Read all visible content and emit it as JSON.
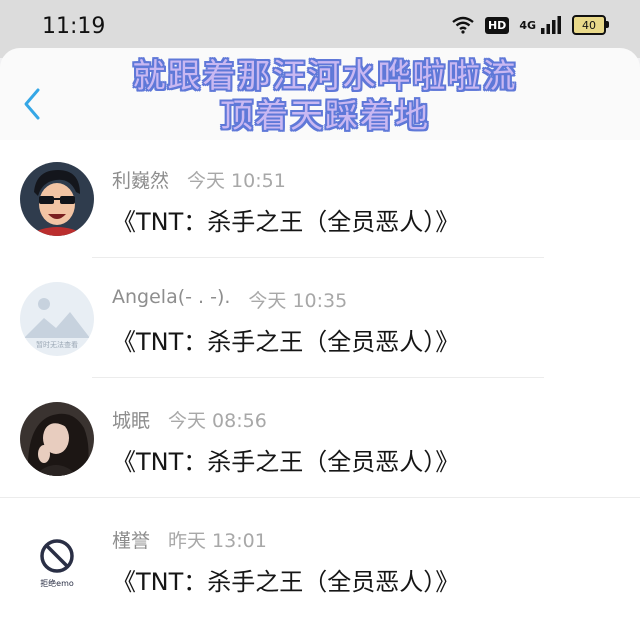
{
  "status_bar": {
    "time": "11:19",
    "hd_label": "HD",
    "network_label": "4G",
    "battery_level": "40"
  },
  "header": {
    "banner_line_1": "就跟着那汪河水哗啦啦流",
    "banner_line_2": "顶着天踩着地"
  },
  "comments": [
    {
      "name": "利巍然",
      "time": "今天 10:51",
      "text": "《TNT：杀手之王（全员恶人）》",
      "avatar": "cartoon-avatar"
    },
    {
      "name": "Angela(- . -).",
      "time": "今天 10:35",
      "text": "《TNT：杀手之王（全员恶人）》",
      "avatar": "placeholder-avatar",
      "avatar_caption": "暂时无法查看"
    },
    {
      "name": "城眠",
      "time": "今天 08:56",
      "text": "《TNT：杀手之王（全员恶人）》",
      "avatar": "photo-avatar"
    },
    {
      "name": "槿誉",
      "time": "昨天 13:01",
      "text": "《TNT：杀手之王（全员恶人）》",
      "avatar": "no-sign-avatar",
      "avatar_caption": "拒绝emo"
    }
  ],
  "colors": {
    "accent_back": "#35a7e6",
    "banner_fill": "#c9b8f2",
    "banner_outline": "#5f78d8"
  }
}
